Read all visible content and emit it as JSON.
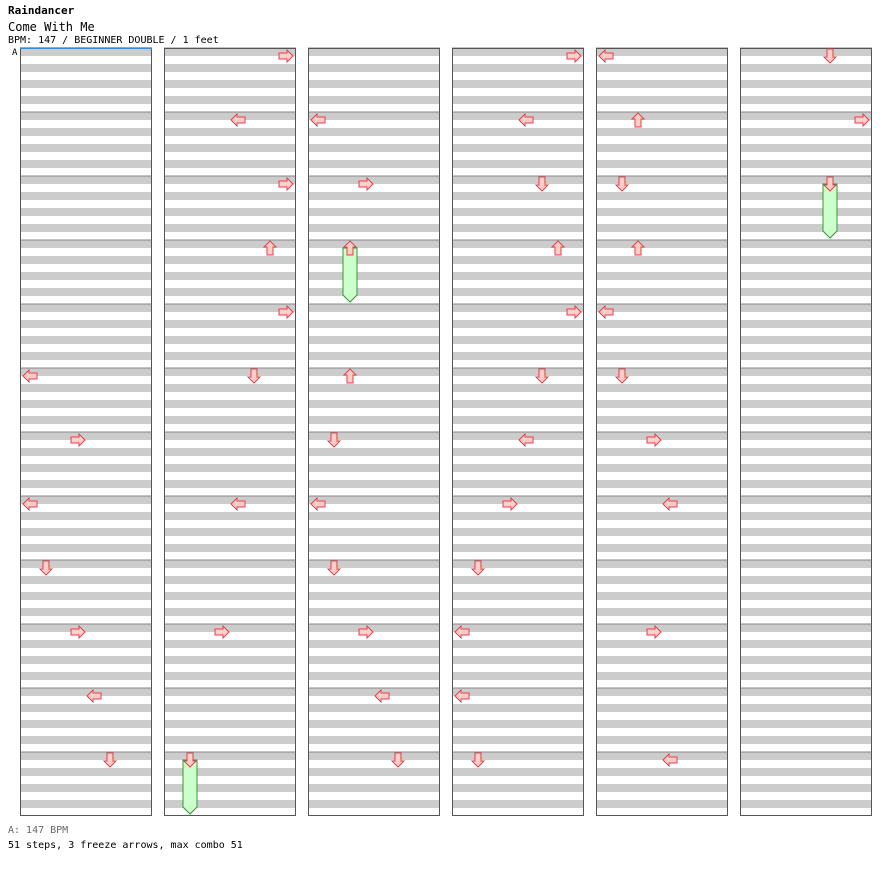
{
  "song": {
    "artist": "Raindancer",
    "title": "Come With Me",
    "info": "BPM: 147 / BEGINNER DOUBLE / 1 feet",
    "marker": "A"
  },
  "footer": {
    "bpm_line": "A: 147 BPM",
    "stats": "51 steps, 3 freeze arrows, max combo 51"
  },
  "colors": {
    "stripe": "#cccccc",
    "arrow_fill": "#ffcccc",
    "arrow_stroke": "#dd4444",
    "freeze_fill": "#ccffcc",
    "freeze_stroke": "#339933",
    "frame": "#555555",
    "marker_line": "#3399ff"
  },
  "chart_data": {
    "type": "step-chart",
    "panels": [
      "L",
      "D",
      "U",
      "R",
      "L",
      "D",
      "U",
      "R"
    ],
    "measures": [
      {
        "steps": [
          [
            0.0,
            "R"
          ]
        ]
      },
      {
        "steps": [
          [
            0.0,
            "L"
          ]
        ]
      },
      {
        "steps": [
          [
            0.0,
            "R"
          ]
        ]
      },
      {
        "steps": [
          [
            0.0,
            "U"
          ]
        ]
      },
      {
        "steps": [
          [
            0.0,
            "R"
          ]
        ]
      },
      {
        "steps": [
          [
            0.0,
            "L"
          ],
          [
            0.0,
            "D"
          ]
        ]
      },
      {
        "steps": [
          [
            0.0,
            "R"
          ]
        ]
      },
      {
        "steps": [
          [
            0.0,
            "L"
          ],
          [
            0.0,
            "L"
          ]
        ]
      },
      {
        "steps": [
          [
            0.0,
            "D"
          ]
        ]
      },
      {
        "steps": [
          [
            0.0,
            "R"
          ],
          [
            0.0,
            "R"
          ]
        ]
      },
      {
        "steps": [
          [
            0.0,
            "L"
          ]
        ]
      },
      {
        "steps": [
          [
            0.0,
            "D"
          ],
          [
            0.0,
            "D"
          ]
        ],
        "freeze": [
          [
            0.0,
            1.0,
            "D"
          ]
        ]
      },
      {
        "steps": [
          [
            0.0,
            "L"
          ]
        ]
      },
      {
        "steps": [
          [
            0.0,
            "U"
          ]
        ]
      },
      {
        "steps": [
          [
            0.0,
            "R"
          ]
        ]
      },
      {
        "steps": [
          [
            0.0,
            "U"
          ]
        ],
        "freeze": [
          [
            0.0,
            1.0,
            "U"
          ]
        ]
      },
      {
        "steps": [
          [
            0.0,
            "U"
          ]
        ]
      },
      {
        "steps": [
          [
            0.0,
            "D"
          ]
        ]
      },
      {
        "steps": [
          [
            0.0,
            "L"
          ]
        ]
      },
      {
        "steps": [
          [
            0.0,
            "D"
          ]
        ]
      },
      {
        "steps": [
          [
            0.0,
            "R"
          ]
        ]
      },
      {
        "steps": [
          [
            0.0,
            "L"
          ]
        ]
      },
      {
        "steps": [
          [
            0.0,
            "R"
          ]
        ]
      },
      {
        "steps": [
          [
            0.0,
            "D"
          ]
        ]
      },
      {
        "steps": [
          [
            0.0,
            "R"
          ]
        ]
      },
      {
        "steps": [
          [
            0.0,
            "L"
          ]
        ]
      },
      {
        "steps": [
          [
            0.0,
            "D"
          ]
        ]
      },
      {
        "steps": [
          [
            0.0,
            "U"
          ]
        ]
      },
      {
        "steps": [
          [
            0.0,
            "R"
          ]
        ]
      },
      {
        "steps": [
          [
            0.0,
            "D"
          ]
        ]
      },
      {
        "steps": [
          [
            0.0,
            "L"
          ]
        ]
      },
      {
        "steps": [
          [
            0.0,
            "R"
          ]
        ]
      },
      {
        "steps": [
          [
            0.0,
            "D"
          ]
        ]
      },
      {
        "steps": [
          [
            0.0,
            "L"
          ]
        ]
      },
      {
        "steps": [
          [
            0.0,
            "L"
          ]
        ]
      },
      {
        "steps": [
          [
            0.0,
            "D"
          ]
        ]
      },
      {
        "steps": [
          [
            0.0,
            "L"
          ]
        ]
      },
      {
        "steps": [
          [
            0.0,
            "U"
          ]
        ]
      },
      {
        "steps": [
          [
            0.0,
            "D"
          ]
        ]
      },
      {
        "steps": [
          [
            0.0,
            "U"
          ]
        ]
      },
      {
        "steps": [
          [
            0.0,
            "L"
          ]
        ]
      },
      {
        "steps": [
          [
            0.0,
            "D"
          ]
        ]
      },
      {
        "steps": [
          [
            0.0,
            "R"
          ]
        ]
      },
      {
        "steps": [
          [
            0.0,
            "L"
          ]
        ]
      },
      {
        "steps": [
          [
            0.0,
            "R"
          ]
        ]
      },
      {
        "steps": [
          [
            0.0,
            "R"
          ]
        ]
      },
      {
        "steps": [
          [
            0.0,
            "L"
          ]
        ]
      },
      {
        "steps": []
      },
      {
        "steps": []
      },
      {
        "steps": []
      },
      {
        "steps": []
      },
      {
        "steps": []
      },
      {
        "steps": []
      },
      {
        "steps": []
      },
      {
        "steps": []
      },
      {
        "steps": []
      },
      {
        "steps": []
      },
      {
        "steps": []
      },
      {
        "steps": []
      },
      {
        "steps": []
      },
      {
        "steps": [
          [
            0.0,
            "D"
          ]
        ],
        "freeze": [
          [
            0.0,
            0.9,
            "D"
          ]
        ]
      },
      {
        "steps": [
          [
            0.0,
            "R"
          ]
        ]
      },
      {
        "steps": []
      },
      {
        "steps": []
      },
      {
        "steps": []
      },
      {
        "steps": []
      },
      {
        "steps": []
      },
      {
        "steps": []
      },
      {
        "steps": []
      },
      {
        "steps": []
      },
      {
        "steps": []
      },
      {
        "steps": []
      }
    ]
  }
}
